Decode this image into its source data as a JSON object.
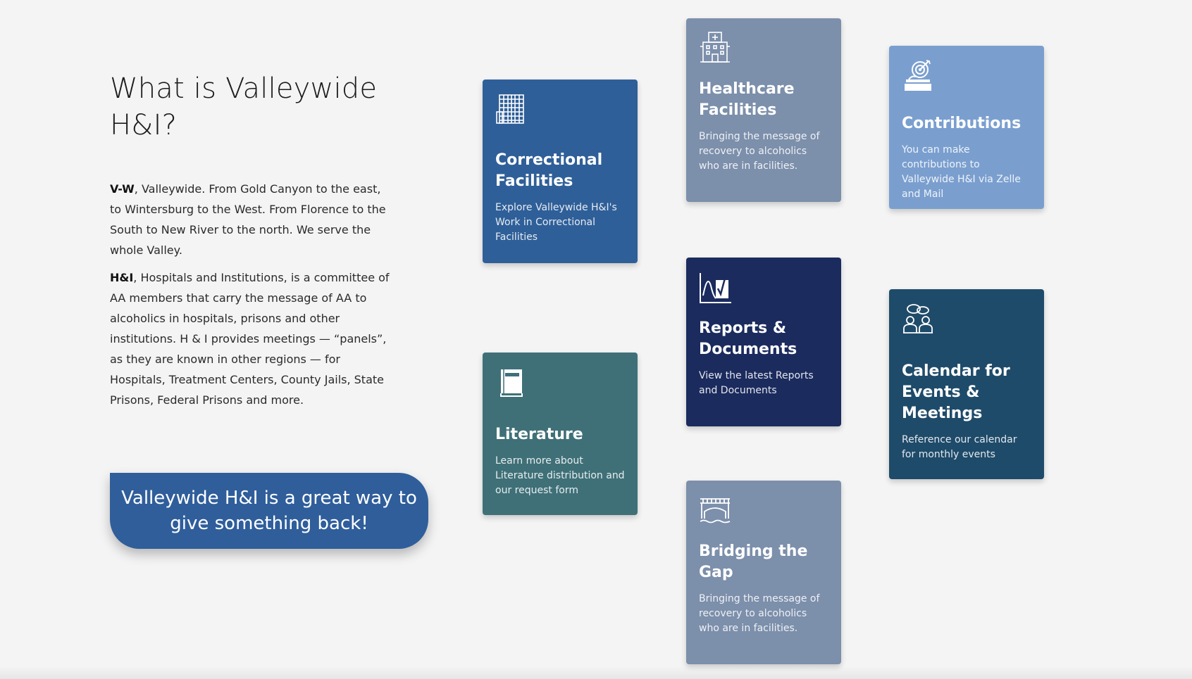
{
  "intro": {
    "heading": "What is Valleywide H&I?",
    "p1_bold": "V-W",
    "p1_text": ", Valleywide. From Gold Canyon to the east, to Wintersburg to the West. From Florence to the South to New River to the north. We serve the whole Valley.",
    "p2_bold": "H&I",
    "p2_text": ", Hospitals and Institutions, is a committee of AA members that carry the message of AA to alcoholics in hospitals, prisons and other institutions. H & I provides meetings — “panels”, as they are known in other regions — for Hospitals, Treatment Centers, County Jails, State Prisons, Federal Prisons and more."
  },
  "cta": {
    "label": "Valleywide H&I is a great way to give something back!"
  },
  "cards": {
    "correctional": {
      "title": "Correctional Facilities",
      "description": "Explore Valleywide H&I's Work in Correctional Facilities",
      "icon": "building-icon",
      "color": "#2f5f98"
    },
    "literature": {
      "title": "Literature",
      "description": "Learn more about Literature distribution and our request form",
      "icon": "book-icon",
      "color": "#3f7078"
    },
    "healthcare": {
      "title": "Healthcare Facilities",
      "description": "Bringing the message of recovery to alcoholics who are in facilities.",
      "icon": "hospital-icon",
      "color": "#7c8fab"
    },
    "reports": {
      "title": "Reports & Documents",
      "description": "View the latest Reports and Documents",
      "icon": "chart-report-icon",
      "color": "#1b2b5e"
    },
    "bridging": {
      "title": "Bridging the Gap",
      "description": "Bringing the message of recovery to alcoholics who are in facilities.",
      "icon": "bridge-icon",
      "color": "#7c8fab"
    },
    "contributions": {
      "title": "Contributions",
      "description": "You can make contributions to Valleywide H&I via Zelle and Mail",
      "icon": "donation-target-icon",
      "color": "#7a9fcf"
    },
    "calendar": {
      "title": "Calendar for Events & Meetings",
      "description": "Reference our calendar for monthly events",
      "icon": "meeting-people-icon",
      "color": "#1f4b6a"
    }
  }
}
